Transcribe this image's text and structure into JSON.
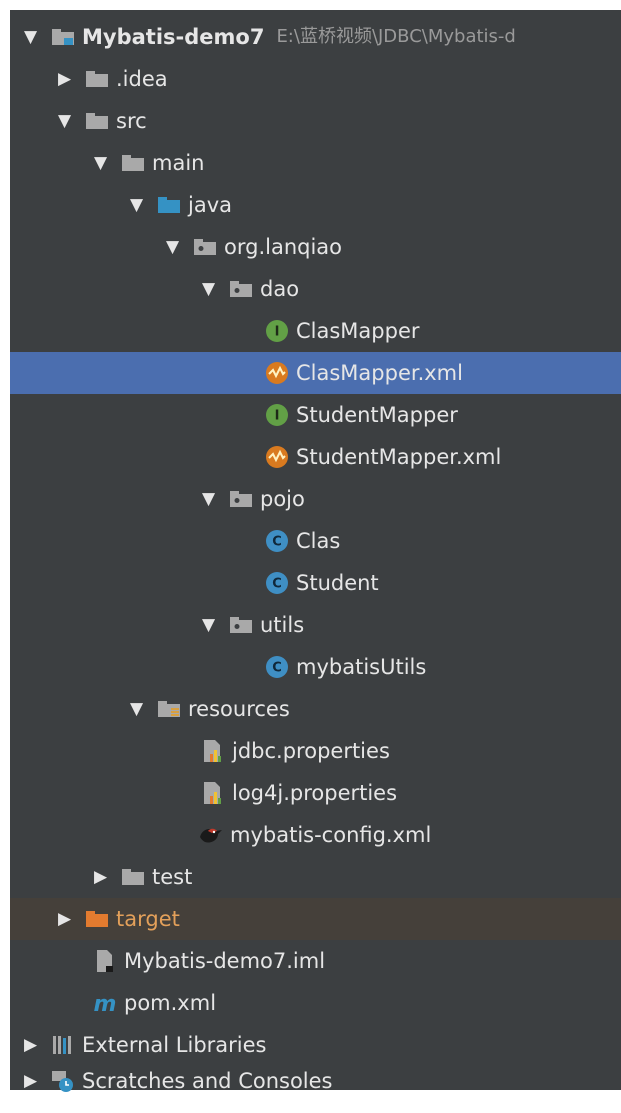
{
  "project": {
    "name": "Mybatis-demo7",
    "path": "E:\\蓝桥视频\\JDBC\\Mybatis-d"
  },
  "nodes": [
    {
      "label": ".idea"
    },
    {
      "label": "src"
    },
    {
      "label": "main"
    },
    {
      "label": "java"
    },
    {
      "label": "org.lanqiao"
    },
    {
      "label": "dao"
    },
    {
      "label": "ClasMapper"
    },
    {
      "label": "ClasMapper.xml"
    },
    {
      "label": "StudentMapper"
    },
    {
      "label": "StudentMapper.xml"
    },
    {
      "label": "pojo"
    },
    {
      "label": "Clas"
    },
    {
      "label": "Student"
    },
    {
      "label": "utils"
    },
    {
      "label": "mybatisUtils"
    },
    {
      "label": "resources"
    },
    {
      "label": "jdbc.properties"
    },
    {
      "label": "log4j.properties"
    },
    {
      "label": "mybatis-config.xml"
    },
    {
      "label": "test"
    },
    {
      "label": "target"
    },
    {
      "label": "Mybatis-demo7.iml"
    },
    {
      "label": "pom.xml"
    },
    {
      "label": "External Libraries"
    },
    {
      "label": "Scratches and Consoles"
    }
  ],
  "colors": {
    "panel_bg": "#3c3f41",
    "selected_bg": "#4b6eaf",
    "excluded_bg": "#45403a",
    "text": "#e6e6e6",
    "muted_text": "#9a9a9a",
    "folder_grey": "#a9a9a9",
    "folder_blue": "#3592c4",
    "folder_orange": "#e37b2f",
    "interface_green": "#62a046",
    "class_blue": "#3f8fc4",
    "xml_orange": "#d97a1f"
  }
}
